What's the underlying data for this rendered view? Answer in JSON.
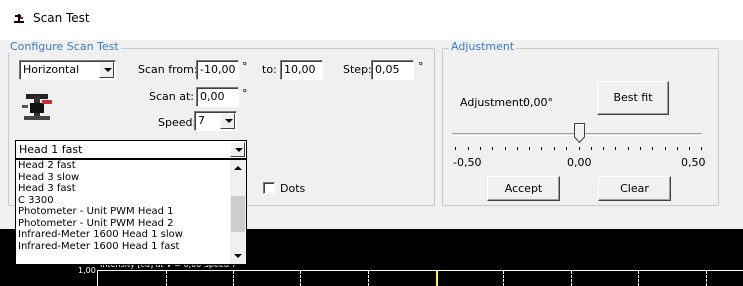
{
  "window": {
    "title": "Scan Test",
    "icon": "microscope-icon"
  },
  "configure": {
    "legend": "Configure Scan Test",
    "direction": "Horizontal",
    "scan_from_label": "Scan from:",
    "scan_from_value": "-10,00",
    "to_label": "to:",
    "to_value": "10,00",
    "step_label": "Step:",
    "step_value": "0,05",
    "degree_unit": "°",
    "scan_at_label": "Scan at:",
    "scan_at_value": "0,00",
    "speed_label": "Speed:",
    "speed_value": "7",
    "profile_value": "Head 1 fast",
    "dots_label": "Dots"
  },
  "profile_list": {
    "items": [
      "Head 2 fast",
      "Head 3 slow",
      "Head 3 fast",
      "C 3300",
      "Photometer - Unit PWM Head 1",
      "Photometer - Unit PWM Head 2",
      "Infrared-Meter 1600 Head 1 slow",
      "Infrared-Meter 1600 Head 1 fast"
    ]
  },
  "adjustment": {
    "legend": "Adjustment",
    "adjustment_label": "Adjustment:",
    "adjustment_value": "0,00°",
    "best_fit_label": "Best fit",
    "slider_min": "-0,50",
    "slider_mid": "0,00",
    "slider_max": "0,50",
    "slider_value": 0.0,
    "accept_label": "Accept",
    "clear_label": "Clear"
  },
  "plot": {
    "y_top_label": "1,00",
    "header_text": "Intensity [cd] at V = 0,00    Speed 7"
  },
  "colors": {
    "legend_text": "#3a7cc8",
    "plot_background": "#000000",
    "cursor_line": "#ffff00"
  }
}
